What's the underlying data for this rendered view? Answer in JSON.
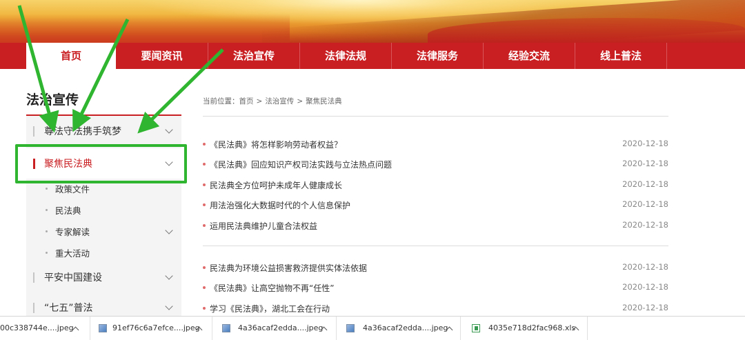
{
  "nav": {
    "items": [
      {
        "label": "首页",
        "active": true
      },
      {
        "label": "要闻资讯",
        "active": false
      },
      {
        "label": "法治宣传",
        "active": false
      },
      {
        "label": "法律法规",
        "active": false
      },
      {
        "label": "法律服务",
        "active": false
      },
      {
        "label": "经验交流",
        "active": false
      },
      {
        "label": "线上普法",
        "active": false
      }
    ]
  },
  "sidebar": {
    "title": "法治宣传",
    "items": [
      {
        "label": "尊法守法携手筑梦",
        "active": false,
        "expandable": true
      },
      {
        "label": "聚焦民法典",
        "active": true,
        "expandable": true
      },
      {
        "label": "平安中国建设",
        "active": false,
        "expandable": true
      },
      {
        "label": "“七五”普法",
        "active": false,
        "expandable": true
      }
    ],
    "subitems": [
      {
        "label": "政策文件",
        "expandable": false
      },
      {
        "label": "民法典",
        "expandable": false
      },
      {
        "label": "专家解读",
        "expandable": true
      },
      {
        "label": "重大活动",
        "expandable": false
      }
    ]
  },
  "breadcrumb": {
    "prefix": "当前位置：",
    "crumbs": [
      "首页",
      "法治宣传",
      "聚焦民法典"
    ],
    "separator": ">"
  },
  "news": {
    "group1": [
      {
        "title": "《民法典》将怎样影响劳动者权益？",
        "date": "2020-12-18"
      },
      {
        "title": "《民法典》回应知识产权司法实践与立法热点问题",
        "date": "2020-12-18"
      },
      {
        "title": "民法典全方位呵护未成年人健康成长",
        "date": "2020-12-18"
      },
      {
        "title": "用法治强化大数据时代的个人信息保护",
        "date": "2020-12-18"
      },
      {
        "title": "运用民法典维护儿童合法权益",
        "date": "2020-12-18"
      }
    ],
    "group2": [
      {
        "title": "民法典为环境公益损害救济提供实体法依据",
        "date": "2020-12-18"
      },
      {
        "title": "《民法典》让高空抛物不再“任性”",
        "date": "2020-12-18"
      },
      {
        "title": "学习《民法典》，湖北工会在行动",
        "date": "2020-12-18"
      }
    ]
  },
  "downloads": [
    {
      "name": "00c338744e....jpeg",
      "type": "image"
    },
    {
      "name": "91ef76c6a7efce....jpeg",
      "type": "image"
    },
    {
      "name": "4a36acaf2edda....jpeg",
      "type": "image"
    },
    {
      "name": "4a36acaf2edda....jpeg",
      "type": "image"
    },
    {
      "name": "4035e718d2fac968.xls",
      "type": "excel"
    }
  ],
  "colors": {
    "brand_red": "#c91e22",
    "annotation_green": "#2fb52f"
  },
  "icons": {
    "chevron": "chevron-down-icon",
    "file_image": "image-file-icon",
    "file_excel": "excel-file-icon",
    "caret_up": "chevron-up-icon"
  }
}
